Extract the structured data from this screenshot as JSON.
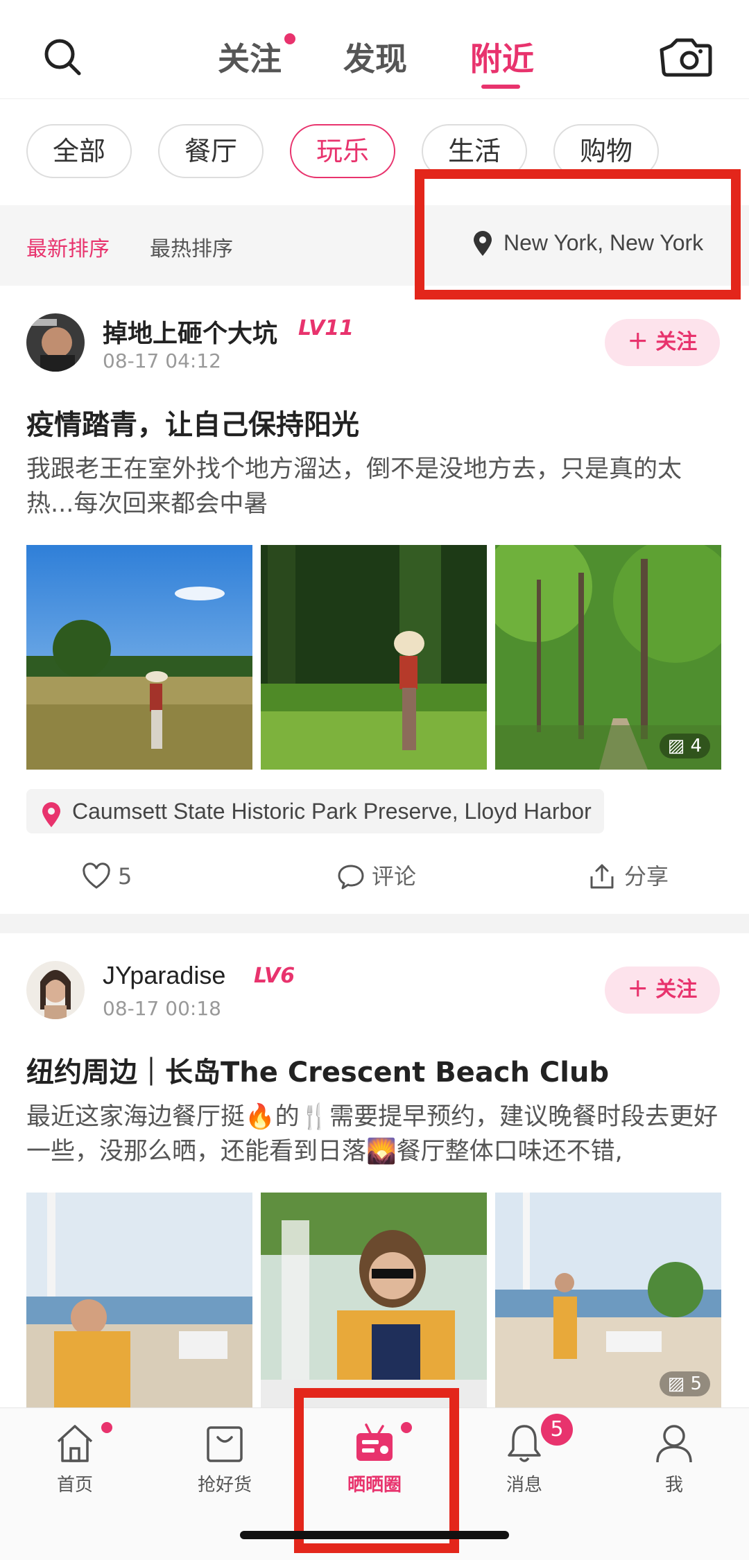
{
  "header": {
    "tabs": [
      {
        "label": "关注",
        "has_dot": true
      },
      {
        "label": "发现"
      },
      {
        "label": "附近",
        "active": true
      }
    ]
  },
  "categories": [
    {
      "label": "全部"
    },
    {
      "label": "餐厅"
    },
    {
      "label": "玩乐",
      "active": true
    },
    {
      "label": "生活"
    },
    {
      "label": "购物"
    }
  ],
  "sort": {
    "newest": "最新排序",
    "hottest": "最热排序",
    "active": "newest",
    "location": "New York, New York"
  },
  "posts": [
    {
      "username": "掉地上砸个大坑",
      "level": "LV11",
      "time": "08-17 04:12",
      "follow_label": "关注",
      "title": "疫情踏青，让自己保持阳光",
      "body": "我跟老王在室外找个地方溜达，倒不是没地方去，只是真的太热...每次回来都会中暑",
      "image_count": "4",
      "place": "Caumsett State Historic Park Preserve, Lloyd Harbor",
      "likes": "5",
      "comment_label": "评论",
      "share_label": "分享"
    },
    {
      "username": "JYparadise",
      "level": "LV6",
      "time": "08-17 00:18",
      "follow_label": "关注",
      "title": "纽约周边｜长岛The Crescent Beach Club",
      "body": "最近这家海边餐厅挺🔥的🍴需要提早预约，建议晚餐时段去更好一些，没那么晒，还能看到日落🌄餐厅整体口味还不错,",
      "image_count": "5"
    }
  ],
  "bottom_nav": [
    {
      "label": "首页",
      "icon": "home-icon",
      "has_dot": true
    },
    {
      "label": "抢好货",
      "icon": "shopping-bag-icon"
    },
    {
      "label": "晒晒圈",
      "icon": "radio-icon",
      "active": true,
      "has_dot": true
    },
    {
      "label": "消息",
      "icon": "bell-icon",
      "badge": "5"
    },
    {
      "label": "我",
      "icon": "person-icon"
    }
  ],
  "colors": {
    "accent": "#e8336d",
    "highlight_box": "#e3261b"
  }
}
